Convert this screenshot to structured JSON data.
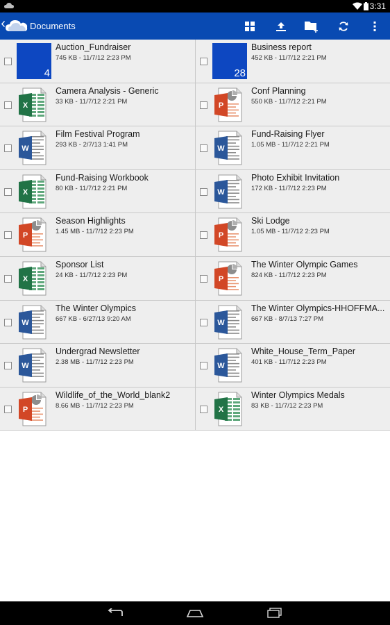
{
  "status": {
    "time": "3:31"
  },
  "header": {
    "title": "Documents"
  },
  "colors": {
    "actionbar": "#094ab2",
    "folder": "#0d47c1",
    "word": "#2b579a",
    "excel": "#217346",
    "powerpoint": "#d24726"
  },
  "files": [
    {
      "name": "Auction_Fundraiser",
      "meta": "745 KB - 11/7/12 2:23 PM",
      "type": "folder",
      "count": "4"
    },
    {
      "name": "Business report",
      "meta": "452 KB - 11/7/12 2:21 PM",
      "type": "folder",
      "count": "28"
    },
    {
      "name": "Camera Analysis - Generic",
      "meta": "33 KB - 11/7/12 2:21 PM",
      "type": "excel"
    },
    {
      "name": "Conf Planning",
      "meta": "550 KB - 11/7/12 2:21 PM",
      "type": "powerpoint"
    },
    {
      "name": "Film Festival Program",
      "meta": "293 KB - 2/7/13 1:41 PM",
      "type": "word"
    },
    {
      "name": "Fund-Raising Flyer",
      "meta": "1.05 MB - 11/7/12 2:21 PM",
      "type": "word"
    },
    {
      "name": "Fund-Raising Workbook",
      "meta": "80 KB - 11/7/12 2:21 PM",
      "type": "excel"
    },
    {
      "name": "Photo Exhibit Invitation",
      "meta": "172 KB - 11/7/12 2:23 PM",
      "type": "word"
    },
    {
      "name": "Season Highlights",
      "meta": "1.45 MB - 11/7/12 2:23 PM",
      "type": "powerpoint"
    },
    {
      "name": "Ski Lodge",
      "meta": "1.05 MB - 11/7/12 2:23 PM",
      "type": "powerpoint"
    },
    {
      "name": "Sponsor List",
      "meta": "24 KB - 11/7/12 2:23 PM",
      "type": "excel"
    },
    {
      "name": "The Winter Olympic Games",
      "meta": "824 KB - 11/7/12 2:23 PM",
      "type": "powerpoint"
    },
    {
      "name": "The Winter Olympics",
      "meta": "667 KB - 6/27/13 9:20 AM",
      "type": "word"
    },
    {
      "name": "The Winter Olympics-HHOFFMA...",
      "meta": "667 KB - 8/7/13 7:27 PM",
      "type": "word"
    },
    {
      "name": "Undergrad Newsletter",
      "meta": "2.38 MB - 11/7/12 2:23 PM",
      "type": "word"
    },
    {
      "name": "White_House_Term_Paper",
      "meta": "401 KB - 11/7/12 2:23 PM",
      "type": "word"
    },
    {
      "name": "Wildlife_of_the_World_blank2",
      "meta": "8.66 MB - 11/7/12 2:23 PM",
      "type": "powerpoint"
    },
    {
      "name": "Winter Olympics Medals",
      "meta": "83 KB - 11/7/12 2:23 PM",
      "type": "excel"
    }
  ]
}
